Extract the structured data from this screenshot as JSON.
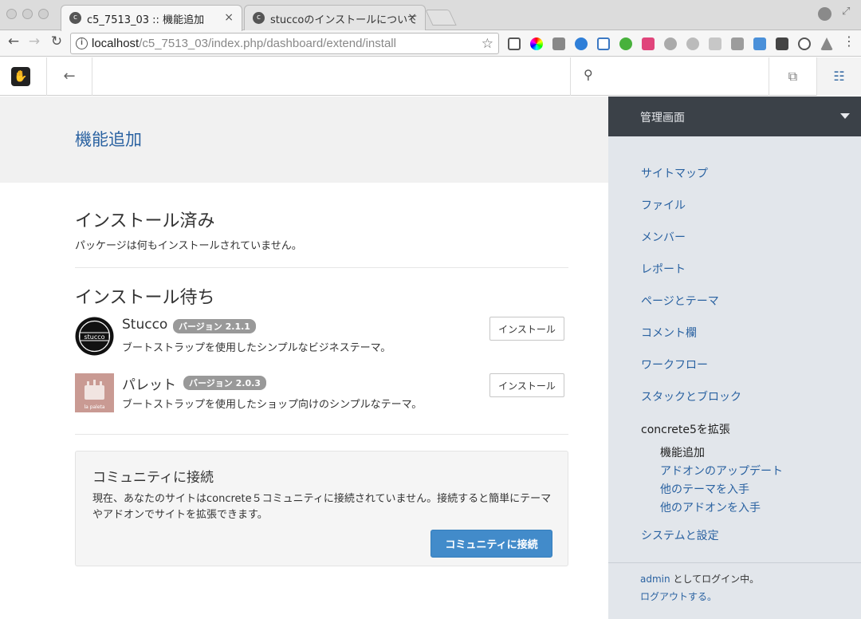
{
  "browser": {
    "tabs": [
      {
        "title": "c5_7513_03 :: 機能追加",
        "close": "×"
      },
      {
        "title": "stuccoのインストールについて",
        "close": "×"
      }
    ],
    "address": {
      "host": "localhost",
      "path": "/c5_7513_03/index.php/dashboard/extend/install"
    }
  },
  "icons": {
    "back": "←",
    "forward": "→",
    "reload": "↻",
    "star": "☆",
    "info": "i",
    "cms_back": "←",
    "search": "⚲",
    "pages": "⧉",
    "settings": "☷"
  },
  "page": {
    "title": "機能追加",
    "installed": {
      "heading": "インストール済み",
      "empty_text": "パッケージは何もインストールされていません。"
    },
    "pending": {
      "heading": "インストール待ち",
      "packages": [
        {
          "name": "Stucco",
          "version": "バージョン 2.1.1",
          "description": "ブートストラップを使用したシンプルなビジネステーマ。",
          "button": "インストール",
          "icon_text": "stucco"
        },
        {
          "name": "パレット",
          "version": "バージョン 2.0.3",
          "description": "ブートストラップを使用したショップ向けのシンプルなテーマ。",
          "button": "インストール",
          "icon_text": "la paleta"
        }
      ]
    },
    "community": {
      "heading": "コミュニティに接続",
      "text": "現在、あなたのサイトはconcrete５コミュニティに接続されていません。接続すると簡単にテーマやアドオンでサイトを拡張できます。",
      "button": "コミュニティに接続"
    }
  },
  "sidebar": {
    "header": "管理画面",
    "items": [
      {
        "label": "サイトマップ"
      },
      {
        "label": "ファイル"
      },
      {
        "label": "メンバー"
      },
      {
        "label": "レポート"
      },
      {
        "label": "ページとテーマ"
      },
      {
        "label": "コメント欄"
      },
      {
        "label": "ワークフロー"
      },
      {
        "label": "スタックとブロック"
      },
      {
        "label": "concrete5を拡張"
      },
      {
        "label": "システムと設定"
      }
    ],
    "subitems": [
      {
        "label": "機能追加"
      },
      {
        "label": "アドオンのアップデート"
      },
      {
        "label": "他のテーマを入手"
      },
      {
        "label": "他のアドオンを入手"
      }
    ],
    "login_user": "admin",
    "login_suffix": " としてログイン中。",
    "logout": "ログアウトする。"
  },
  "colors": {
    "accent": "#2a62a1",
    "primary_button": "#428bca",
    "sidebar_header": "#3b4148",
    "sidebar_bg": "#e2e6eb"
  }
}
